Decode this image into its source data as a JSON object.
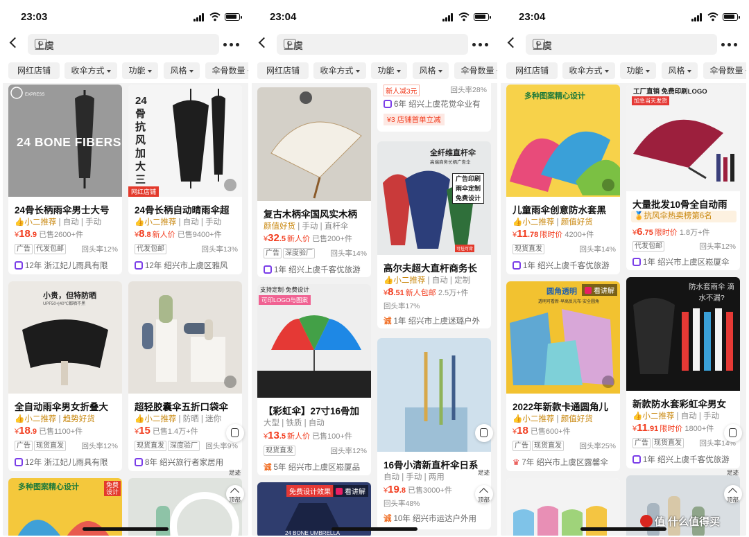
{
  "phones": [
    {
      "time": "23:03",
      "query": "上虞"
    },
    {
      "time": "23:04",
      "query": "上虞"
    },
    {
      "time": "23:04",
      "query": "上虞"
    }
  ],
  "filters": [
    "网红店铺",
    "收伞方式",
    "功能",
    "风格",
    "伞骨数量"
  ],
  "floaters": {
    "note": "",
    "footprint": "足迹",
    "top": "顶部"
  },
  "p1": {
    "c1": {
      "imgtext": "24 BONE FIBERS",
      "badge": "EXPRESS",
      "title": "24骨长柄雨伞男士大号",
      "tags": [
        "小二推荐",
        "自动",
        "手动"
      ],
      "price": "18",
      "dec": ".9",
      "sold": "已售2600+件",
      "boxes": [
        "广告",
        "代发包邮"
      ],
      "repurchase": "回头率12%",
      "years": "12年",
      "shop": "浙江妃儿雨具有限"
    },
    "c2": {
      "imgtext": "24骨抗风加大三人",
      "badge": "网红店铺",
      "title": "24骨长柄自动晴雨伞超",
      "tags": [
        "小二推荐",
        "自动",
        "手动"
      ],
      "price": "8",
      "dec": ".8",
      "newp": "新人价",
      "sold": "已售9400+件",
      "boxes": [
        "代发包邮"
      ],
      "repurchase": "回头率13%",
      "years": "12年",
      "shop": "绍兴市上虞区雅风"
    },
    "c3": {
      "imgtext": "小贵，但特防晒",
      "imgsub": "UPF50+|40℃都晒不黑",
      "title": "全自动雨伞男女折叠大",
      "tags": [
        "小二推荐",
        "趋势好货"
      ],
      "price": "18",
      "dec": ".9",
      "sold": "已售1100+件",
      "boxes": [
        "广告",
        "现货直发"
      ],
      "repurchase": "回头率12%",
      "years": "12年",
      "shop": "浙江妃儿雨具有限"
    },
    "c4": {
      "title": "超轻胶囊伞五折口袋伞",
      "tags": [
        "小二推荐",
        "防晒",
        "迷你"
      ],
      "price": "15",
      "dec": "",
      "sold": "已售1.4万+件",
      "boxes": [
        "现货直发",
        "深度验厂"
      ],
      "repurchase": "回头率9%",
      "years": "8年",
      "shop": "绍兴旅行者家居用"
    },
    "c5": {
      "imgtext": "多种图案精心设计",
      "stamp": "免费设计"
    },
    "c6": {}
  },
  "p2": {
    "c0": {
      "promo": "新人减3元",
      "repurchase": "回头率28%",
      "years": "6年",
      "shop": "绍兴上虞花觉伞业有",
      "coupon": "¥3 店铺首单立减"
    },
    "c1": {
      "title": "复古木柄伞国风实木柄",
      "tags": [
        "颜值好货",
        "手动",
        "直杆伞"
      ],
      "price": "32",
      "dec": ".5",
      "newp": "新人价",
      "sold": "已售200+件",
      "boxes": [
        "广告",
        "深度验厂"
      ],
      "repurchase": "回头率14%",
      "years": "1年",
      "shop": "绍兴上虞千客优旅游"
    },
    "c2": {
      "imgtext": "全纤维直杆伞",
      "imgsub": "高端商务长柄广告伞",
      "box": [
        "广告印刷",
        "雨伞定制",
        "免费设计"
      ],
      "hook": "可挂可背",
      "title": "高尔夫超大直杆商务长",
      "tags": [
        "小二推荐",
        "自动",
        "定制"
      ],
      "price": "8",
      "dec": ".51",
      "newp": "新人包邮",
      "sold": "2.5万+件",
      "repurchase": "回头率17%",
      "years": "1年",
      "shop": "绍兴市上虞迷璐户外"
    },
    "c3": {
      "imgtext": "支持定制·免费设计",
      "imgsub": "可印LOGO与图案",
      "title": "【彩虹伞】27寸16骨加",
      "tags": [
        "大型",
        "铁质",
        "自动"
      ],
      "price": "13",
      "dec": ".5",
      "newp": "新人价",
      "sold": "已售100+件",
      "boxes": [
        "现货直发"
      ],
      "repurchase": "回头率12%",
      "years": "5年",
      "shop": "绍兴市上虞区崧厦品"
    },
    "c4": {
      "title": "16骨小清新直杆伞日系",
      "tags": [
        "自动",
        "手动",
        "两用"
      ],
      "price": "19",
      "dec": ".8",
      "sold": "已售3000+件",
      "repurchase": "回头率48%",
      "years": "10年",
      "shop": "绍兴市运达户外用"
    },
    "c5": {
      "imgtext": "免费设计效果",
      "watch": "看讲解",
      "sub": "24 BONE UMBRELLA"
    }
  },
  "p3": {
    "c1": {
      "imgtext": "多种图案精心设计",
      "title": "儿童雨伞创意防水套黑",
      "tags": [
        "小二推荐",
        "颜值好货"
      ],
      "price": "11",
      "dec": ".78",
      "limit": "限时价",
      "sold": "4200+件",
      "boxes": [
        "现货直发"
      ],
      "repurchase": "回头率14%",
      "years": "1年",
      "shop": "绍兴上虞千客优旅游"
    },
    "c2": {
      "imgtext": "工厂直销 免费印刷LOGO",
      "imgsub": "加急当天发货",
      "title": "大量批发10骨全自动雨",
      "rank": "抗风伞热卖榜第6名",
      "price": "6",
      "dec": ".75",
      "limit": "限时价",
      "sold": "1.8万+件",
      "boxes": [
        "代发包邮"
      ],
      "repurchase": "回头率12%",
      "years": "1年",
      "shop": "绍兴市上虞区崧厦伞"
    },
    "c3": {
      "imgtext": "圆角透明",
      "watch": "看讲解",
      "imgsub": "透明可看新·早高反光布·安全圆角",
      "title": "2022年新款卡通圆角儿",
      "tags": [
        "小二推荐",
        "颜值好货"
      ],
      "price": "18",
      "dec": "",
      "sold": "已售600+件",
      "boxes": [
        "广告",
        "现货直发"
      ],
      "repurchase": "回头率25%",
      "years": "7年",
      "shop": "绍兴市上虞区露馨伞"
    },
    "c4": {
      "imgtext": "防水套雨伞 滴水不漏?",
      "title": "新款防水套彩虹伞男女",
      "tags": [
        "小二推荐",
        "自动",
        "手动"
      ],
      "price": "11",
      "dec": ".91",
      "limit": "限时价",
      "sold": "1800+件",
      "boxes": [
        "广告",
        "现货直发"
      ],
      "repurchase": "回头率14%",
      "years": "1年",
      "shop": "绍兴上虞千客优旅游"
    }
  },
  "watermark": "值 什么值得买",
  "colors": {
    "price": "#f23c1e",
    "accent": "#ff5000",
    "purple": "#7a3de8",
    "gold": "#c8860b"
  }
}
